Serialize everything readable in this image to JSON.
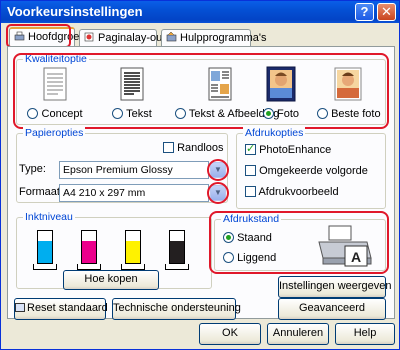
{
  "window": {
    "title": "Voorkeursinstellingen",
    "help_glyph": "?",
    "close_glyph": "✕"
  },
  "tabs": [
    {
      "label": "Hoofdgroep",
      "active": true
    },
    {
      "label": "Paginalay-out",
      "active": false
    },
    {
      "label": "Hulpprogramma's",
      "active": false
    }
  ],
  "quality": {
    "label": "Kwaliteitoptie",
    "options": [
      {
        "label": "Concept",
        "selected": false
      },
      {
        "label": "Tekst",
        "selected": false
      },
      {
        "label": "Tekst & Afbeelding",
        "selected": false
      },
      {
        "label": "Foto",
        "selected": true
      },
      {
        "label": "Beste foto",
        "selected": false
      }
    ]
  },
  "paper": {
    "label": "Papieropties",
    "borderless_label": "Randloos",
    "borderless_checked": false,
    "type_label": "Type:",
    "type_value": "Epson Premium Glossy",
    "format_label": "Formaat:",
    "format_value": "A4 210 x 297 mm"
  },
  "print_options": {
    "label": "Afdrukopties",
    "items": [
      {
        "label": "PhotoEnhance",
        "checked": true
      },
      {
        "label": "Omgekeerde volgorde",
        "checked": false
      },
      {
        "label": "Afdrukvoorbeeld",
        "checked": false
      }
    ]
  },
  "ink": {
    "label": "Inktniveau",
    "colors": [
      "#00aeef",
      "#ec008c",
      "#fff200",
      "#231f20"
    ],
    "button": "Hoe kopen"
  },
  "orientation": {
    "label": "Afdrukstand",
    "options": [
      {
        "label": "Staand",
        "selected": true
      },
      {
        "label": "Liggend",
        "selected": false
      }
    ]
  },
  "buttons": {
    "reset": "Reset standaard",
    "tech_support": "Technische ondersteuning",
    "show_settings": "Instellingen weergeven",
    "advanced": "Geavanceerd",
    "ok": "OK",
    "cancel": "Annuleren",
    "help": "Help"
  }
}
